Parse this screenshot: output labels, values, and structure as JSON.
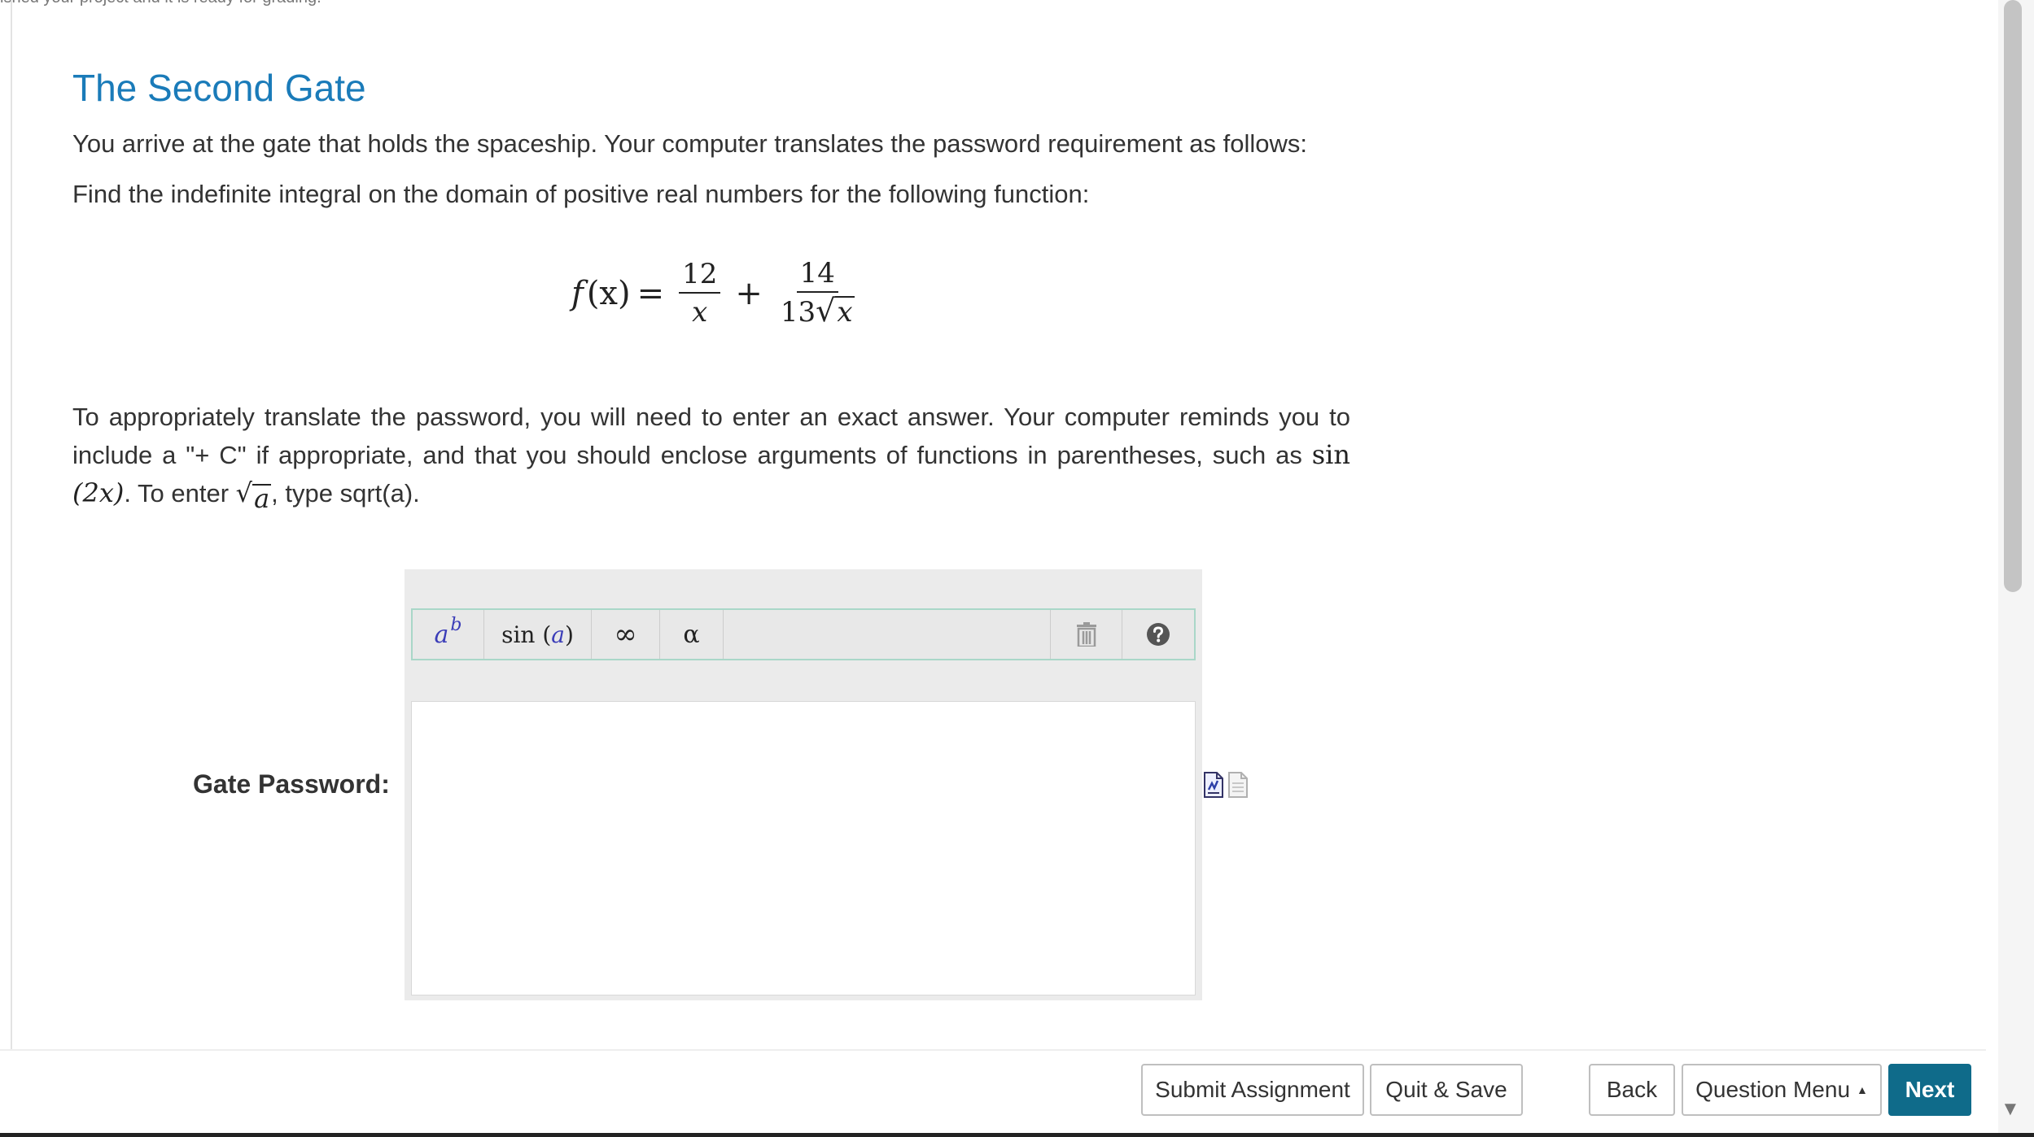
{
  "top_clipped_text": "ished your project and it is ready for grading.",
  "title": "The Second Gate",
  "intro": "You arrive at the gate that holds the spaceship. Your computer translates the password requirement as follows:",
  "prompt": "Find the indefinite integral on the domain of positive real numbers for the following function:",
  "formula": {
    "lhs": "f",
    "arg": "(x)",
    "equals": "=",
    "frac1_num": "12",
    "frac1_den": "x",
    "plus": "+",
    "frac2_num": "14",
    "frac2_den_coeff": "13",
    "frac2_den_radicand": "x"
  },
  "instructions": {
    "part1": "To appropriately translate the password, you will need to enter an exact answer. Your computer reminds you to include a \"+ C\" if appropriate, and that you should enclose arguments of functions in parentheses, such as ",
    "example_fn": "sin",
    "example_arg": "(2x)",
    "part2": ". To enter ",
    "sqrt_radicand": "a",
    "part3": ", type sqrt(a)."
  },
  "toolbar": {
    "power_base": "a",
    "power_exp": "b",
    "function_name": "sin",
    "function_open": "(",
    "function_arg": "a",
    "function_close": ")",
    "infinity": "∞",
    "greek": "α"
  },
  "answer": {
    "label": "Gate Password:",
    "value": ""
  },
  "buttons": {
    "submit": "Submit Assignment",
    "quit": "Quit & Save",
    "back": "Back",
    "question_menu": "Question Menu",
    "next": "Next"
  },
  "icons": {
    "trash": "trash-icon",
    "help": "help-icon",
    "equation_preview": "equation-preview-icon",
    "document": "document-icon"
  },
  "colors": {
    "title": "#1a7bb9",
    "next_button": "#0f6b8a",
    "toolbar_border": "#a9d7c8"
  }
}
